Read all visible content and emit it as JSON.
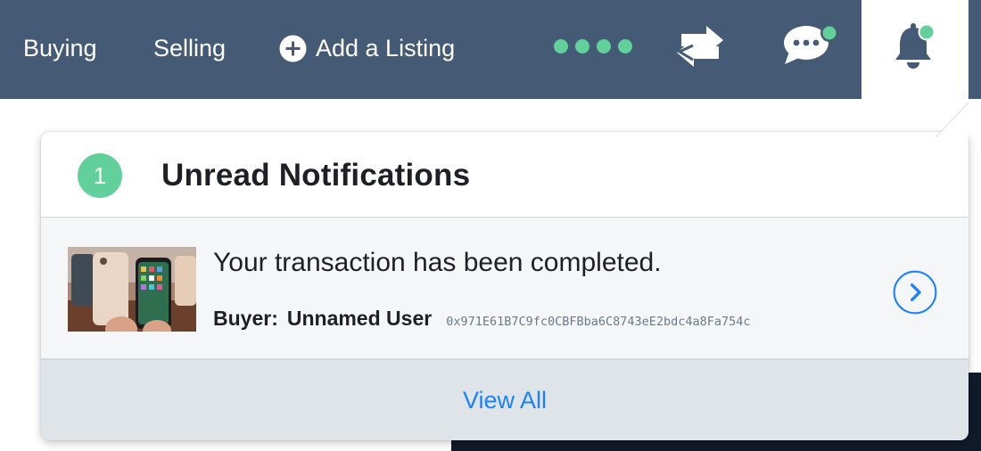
{
  "nav": {
    "buying_label": "Buying",
    "selling_label": "Selling",
    "add_listing_label": "Add a Listing",
    "icons": [
      "plus-circle-icon",
      "network-dots-icon",
      "transfer-icon",
      "chat-icon",
      "bell-icon"
    ]
  },
  "notifications": {
    "unread_count": "1",
    "title": "Unread Notifications",
    "items": [
      {
        "message": "Your transaction has been completed.",
        "buyer_label": "Buyer:",
        "buyer_name": "Unnamed User",
        "buyer_address": "0x971E61B7C9fc0CBFBba6C8743eE2bdc4a8Fa754c",
        "thumbnail": "phone-listing-thumbnail"
      }
    ],
    "view_all_label": "View All"
  },
  "colors": {
    "navbar": "#455a74",
    "accent_green": "#61d09a",
    "link_blue": "#1a82ff",
    "title_text": "#1e2026",
    "footer_bg": "#dfe4e9"
  }
}
